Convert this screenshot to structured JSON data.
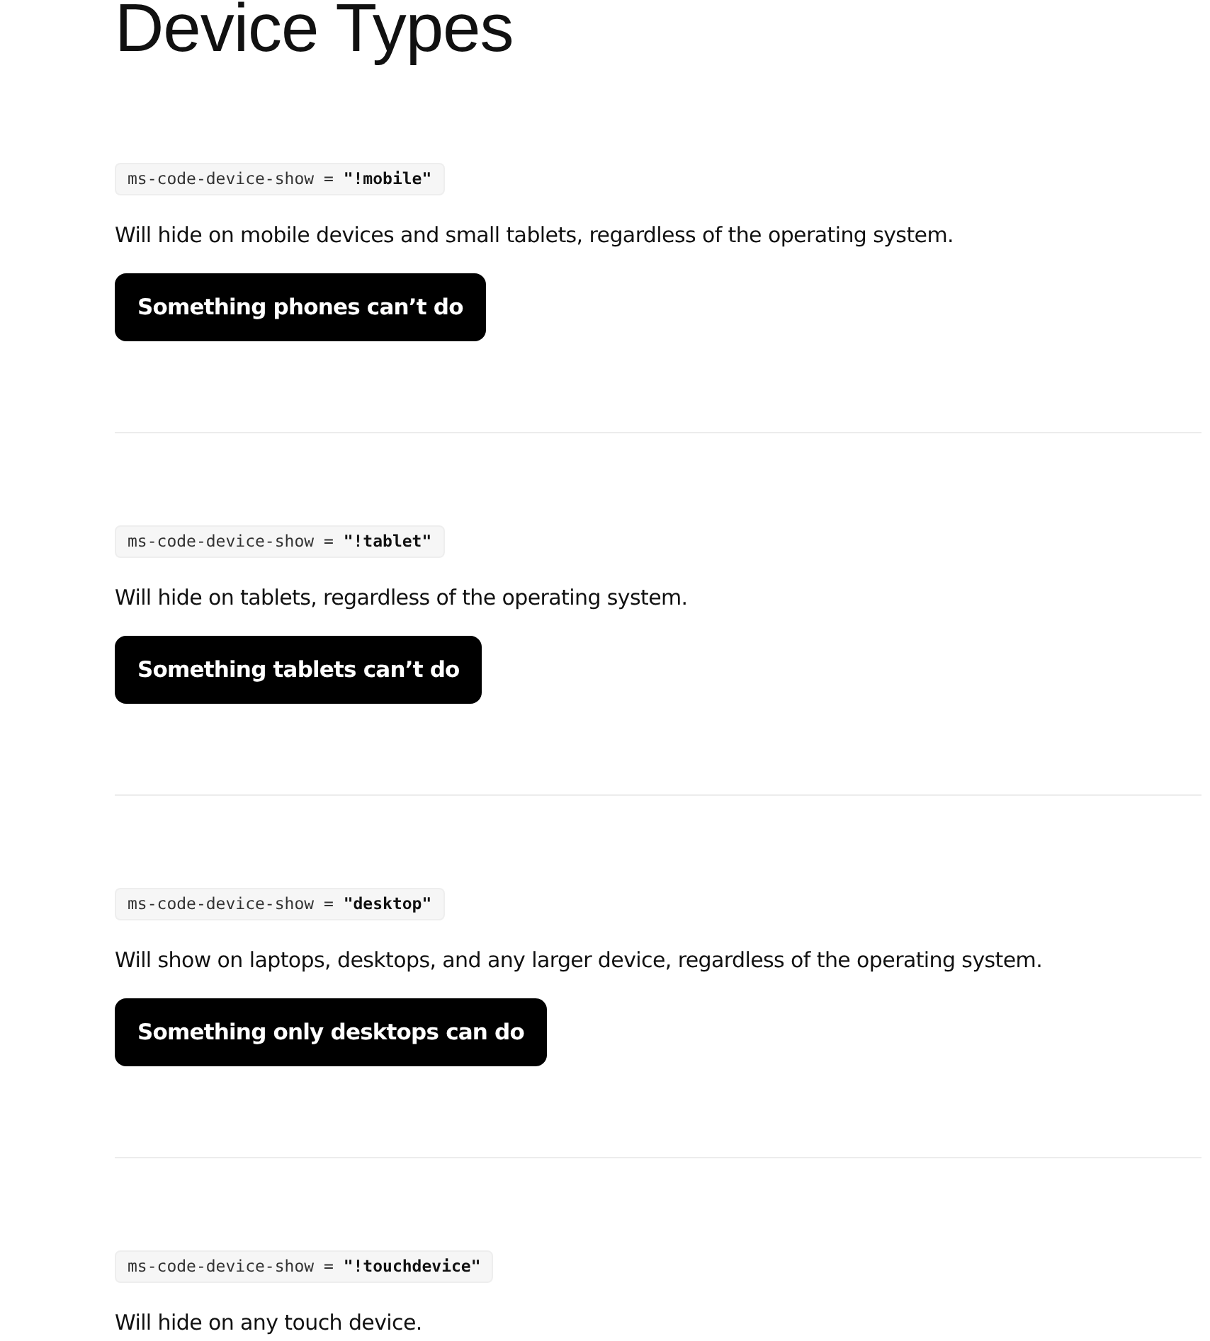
{
  "title": "Device Types",
  "sections": [
    {
      "code": "ms-code-device-show = **\"!mobile\"**",
      "description": "Will hide on mobile devices and small tablets, regardless of the operating system.",
      "button": "Something phones can’t do"
    },
    {
      "code": "ms-code-device-show = **\"!tablet\"**",
      "description": "Will hide on tablets, regardless of the operating system.",
      "button": "Something tablets can’t do"
    },
    {
      "code": "ms-code-device-show = **\"desktop\"**",
      "description": "Will show on laptops, desktops, and any larger device, regardless of the operating system.",
      "button": "Something only desktops can do"
    },
    {
      "code": "ms-code-device-show = **\"!touchdevice\"**",
      "description": "Will hide on any touch device."
    }
  ]
}
